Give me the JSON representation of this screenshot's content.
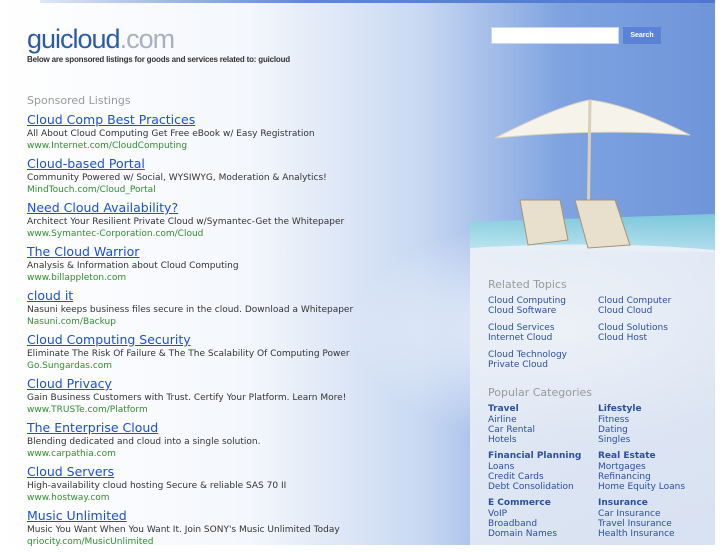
{
  "header": {
    "logo_name": "guicloud",
    "logo_tld": ".com",
    "tagline": "Below are sponsored listings for goods and services related to: guicloud"
  },
  "search": {
    "value": "",
    "button_label": "Search"
  },
  "sponsored": {
    "title": "Sponsored Listings",
    "items": [
      {
        "title": "Cloud Comp Best Practices",
        "desc": "All About Cloud Computing Get Free eBook w/ Easy Registration",
        "url": "www.Internet.com/CloudComputing"
      },
      {
        "title": "Cloud-based Portal",
        "desc": "Community Powered w/ Social, WYSIWYG, Moderation & Analytics!",
        "url": "MindTouch.com/Cloud_Portal"
      },
      {
        "title": "Need Cloud Availability?",
        "desc": "Architect Your Resilient Private Cloud w/Symantec-Get the Whitepaper",
        "url": "www.Symantec-Corporation.com/Cloud"
      },
      {
        "title": "The Cloud Warrior",
        "desc": "Analysis & Information about Cloud Computing",
        "url": "www.billappleton.com"
      },
      {
        "title": "cloud it",
        "desc": "Nasuni keeps business files secure in the cloud. Download a Whitepaper",
        "url": "Nasuni.com/Backup"
      },
      {
        "title": "Cloud Computing Security",
        "desc": "Eliminate The Risk Of Failure & The The Scalability Of Computing Power",
        "url": "Go.Sungardas.com"
      },
      {
        "title": "Cloud Privacy",
        "desc": "Gain Business Customers with Trust. Certify Your Platform. Learn More!",
        "url": "www.TRUSTe.com/Platform"
      },
      {
        "title": "The Enterprise Cloud",
        "desc": "Blending dedicated and cloud into a single solution.",
        "url": "www.carpathia.com"
      },
      {
        "title": "Cloud Servers",
        "desc": "High-availability cloud hosting Secure & reliable SAS 70 II",
        "url": "www.hostway.com"
      },
      {
        "title": "Music Unlimited",
        "desc": "Music You Want When You Want It. Join SONY's Music Unlimited Today",
        "url": "qriocity.com/MusicUnlimited"
      }
    ]
  },
  "related": {
    "title": "Related Topics",
    "groups": [
      [
        [
          "Cloud Computing",
          "Cloud Software"
        ],
        [
          "Cloud Computer",
          "Cloud Cloud"
        ]
      ],
      [
        [
          "Cloud Services",
          "Internet Cloud"
        ],
        [
          "Cloud Solutions",
          "Cloud Host"
        ]
      ],
      [
        [
          "Cloud Technology",
          "Private Cloud"
        ],
        []
      ]
    ]
  },
  "popular": {
    "title": "Popular Categories",
    "groups": [
      [
        {
          "head": "Travel",
          "links": [
            "Airline",
            "Car Rental",
            "Hotels"
          ]
        },
        {
          "head": "Lifestyle",
          "links": [
            "Fitness",
            "Dating",
            "Singles"
          ]
        }
      ],
      [
        {
          "head": "Financial Planning",
          "links": [
            "Loans",
            "Credit Cards",
            "Debt Consolidation"
          ]
        },
        {
          "head": "Real Estate",
          "links": [
            "Mortgages",
            "Refinancing",
            "Home Equity Loans"
          ]
        }
      ],
      [
        {
          "head": "E Commerce",
          "links": [
            "VoIP",
            "Broadband",
            "Domain Names"
          ]
        },
        {
          "head": "Insurance",
          "links": [
            "Car Insurance",
            "Travel Insurance",
            "Health Insurance"
          ]
        }
      ]
    ]
  }
}
